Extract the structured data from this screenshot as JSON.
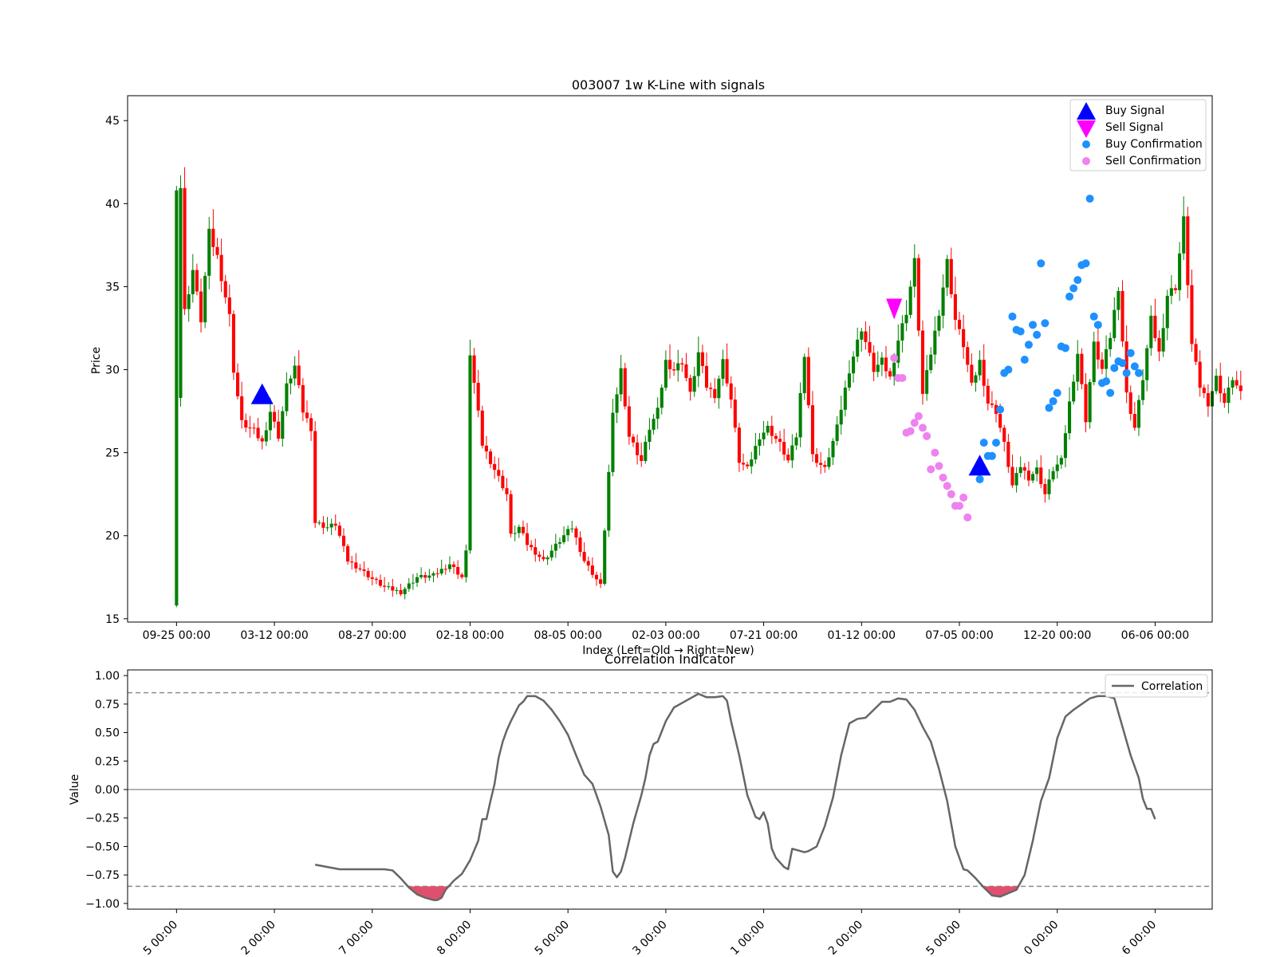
{
  "chart_data": [
    {
      "type": "candlestick",
      "title": "003007 1w K-Line with signals",
      "xlabel": "Index (Left=Old → Right=New)",
      "ylabel": "Price",
      "ylim": [
        14.8,
        46.5
      ],
      "yticks": [
        15,
        20,
        25,
        30,
        35,
        40,
        45
      ],
      "xtick_labels": [
        "09-25 00:00",
        "03-12 00:00",
        "08-27 00:00",
        "02-18 00:00",
        "08-05 00:00",
        "02-03 00:00",
        "07-21 00:00",
        "01-12 00:00",
        "07-05 00:00",
        "12-20 00:00",
        "06-06 00:00"
      ],
      "xtick_index": [
        0,
        24,
        48,
        72,
        96,
        120,
        144,
        168,
        192,
        216,
        240
      ],
      "xlim": [
        -12,
        254
      ],
      "candle_colors": {
        "up": "#008000",
        "down": "#ff0000"
      },
      "close_anchors": [
        [
          0,
          28.3
        ],
        [
          1,
          41.0
        ],
        [
          2,
          33.5
        ],
        [
          4,
          36.0
        ],
        [
          6,
          33.0
        ],
        [
          8,
          38.2
        ],
        [
          10,
          36.8
        ],
        [
          13,
          33.2
        ],
        [
          14,
          30.0
        ],
        [
          16,
          26.8
        ],
        [
          19,
          26.3
        ],
        [
          21,
          25.6
        ],
        [
          23,
          27.5
        ],
        [
          25,
          26.0
        ],
        [
          27,
          29.0
        ],
        [
          29,
          30.2
        ],
        [
          31,
          27.5
        ],
        [
          33,
          26.5
        ],
        [
          34,
          20.8
        ],
        [
          37,
          20.5
        ],
        [
          39,
          20.7
        ],
        [
          42,
          18.5
        ],
        [
          45,
          18.0
        ],
        [
          48,
          17.4
        ],
        [
          51,
          16.9
        ],
        [
          55,
          16.6
        ],
        [
          59,
          17.5
        ],
        [
          63,
          17.6
        ],
        [
          67,
          18.3
        ],
        [
          70,
          17.5
        ],
        [
          71,
          19.0
        ],
        [
          72,
          31.0
        ],
        [
          75,
          25.5
        ],
        [
          78,
          24.0
        ],
        [
          81,
          22.5
        ],
        [
          82,
          20.0
        ],
        [
          84,
          20.5
        ],
        [
          86,
          19.5
        ],
        [
          90,
          18.5
        ],
        [
          95,
          20.0
        ],
        [
          97,
          20.5
        ],
        [
          100,
          18.5
        ],
        [
          104,
          17.0
        ],
        [
          107,
          27.2
        ],
        [
          109,
          30.0
        ],
        [
          111,
          26.0
        ],
        [
          114,
          24.5
        ],
        [
          116,
          26.5
        ],
        [
          118,
          27.5
        ],
        [
          120,
          30.5
        ],
        [
          122,
          30.0
        ],
        [
          124,
          30.5
        ],
        [
          126,
          28.5
        ],
        [
          128,
          31.0
        ],
        [
          130,
          29.0
        ],
        [
          132,
          28.5
        ],
        [
          134,
          30.5
        ],
        [
          136,
          28.2
        ],
        [
          138,
          24.5
        ],
        [
          140,
          24.0
        ],
        [
          143,
          26.0
        ],
        [
          145,
          26.5
        ],
        [
          148,
          25.5
        ],
        [
          150,
          24.5
        ],
        [
          152,
          26.0
        ],
        [
          154,
          31.0
        ],
        [
          156,
          24.8
        ],
        [
          159,
          24.0
        ],
        [
          162,
          26.5
        ],
        [
          165,
          30.0
        ],
        [
          168,
          32.5
        ],
        [
          171,
          30.0
        ],
        [
          173,
          30.5
        ],
        [
          175,
          29.5
        ],
        [
          177,
          31.8
        ],
        [
          179,
          33.5
        ],
        [
          181,
          36.5
        ],
        [
          183,
          28.5
        ],
        [
          185,
          31.0
        ],
        [
          187,
          33.5
        ],
        [
          189,
          36.5
        ],
        [
          191,
          33.0
        ],
        [
          193,
          31.5
        ],
        [
          195,
          29.0
        ],
        [
          197,
          30.5
        ],
        [
          199,
          28.0
        ],
        [
          201,
          27.5
        ],
        [
          203,
          25.5
        ],
        [
          205,
          23.0
        ],
        [
          207,
          24.2
        ],
        [
          209,
          23.5
        ],
        [
          211,
          24.0
        ],
        [
          213,
          22.5
        ],
        [
          215,
          24.0
        ],
        [
          217,
          24.5
        ],
        [
          219,
          28.0
        ],
        [
          221,
          31.0
        ],
        [
          223,
          27.0
        ],
        [
          225,
          31.5
        ],
        [
          227,
          30.0
        ],
        [
          229,
          32.0
        ],
        [
          231,
          35.0
        ],
        [
          233,
          28.5
        ],
        [
          235,
          26.5
        ],
        [
          237,
          29.5
        ],
        [
          239,
          33.0
        ],
        [
          241,
          31.0
        ],
        [
          243,
          34.5
        ],
        [
          245,
          35.0
        ],
        [
          247,
          39.0
        ],
        [
          249,
          31.5
        ],
        [
          251,
          29.0
        ],
        [
          253,
          28.0
        ],
        [
          255,
          29.5
        ],
        [
          257,
          28.0
        ],
        [
          259,
          29.5
        ],
        [
          261,
          28.5
        ]
      ],
      "annotations": {
        "buy_signal_label": "Buy Signal",
        "sell_signal_label": "Sell Signal",
        "buy_confirmation_label": "Buy Confirmation",
        "sell_confirmation_label": "Sell Confirmation",
        "buy_signals": [
          [
            21,
            28.5
          ],
          [
            197,
            24.2
          ]
        ],
        "sell_signals": [
          [
            176,
            33.7
          ]
        ],
        "buy_confirmations": [
          [
            197,
            23.4
          ],
          [
            198,
            25.6
          ],
          [
            199,
            24.8
          ],
          [
            200,
            24.8
          ],
          [
            201,
            25.6
          ],
          [
            202,
            27.6
          ],
          [
            203,
            29.8
          ],
          [
            204,
            30.0
          ],
          [
            205,
            33.2
          ],
          [
            206,
            32.4
          ],
          [
            207,
            32.3
          ],
          [
            208,
            30.6
          ],
          [
            209,
            31.5
          ],
          [
            210,
            32.7
          ],
          [
            211,
            32.1
          ],
          [
            212,
            36.4
          ],
          [
            213,
            32.8
          ],
          [
            214,
            27.7
          ],
          [
            215,
            28.1
          ],
          [
            216,
            28.6
          ],
          [
            217,
            31.4
          ],
          [
            218,
            31.3
          ],
          [
            219,
            34.4
          ],
          [
            220,
            34.9
          ],
          [
            221,
            35.4
          ],
          [
            222,
            36.3
          ],
          [
            223,
            36.4
          ],
          [
            224,
            40.3
          ],
          [
            225,
            33.2
          ],
          [
            226,
            32.7
          ],
          [
            227,
            29.2
          ],
          [
            228,
            29.3
          ],
          [
            229,
            28.6
          ],
          [
            230,
            30.1
          ],
          [
            231,
            30.5
          ],
          [
            232,
            30.4
          ],
          [
            233,
            29.8
          ],
          [
            234,
            31.0
          ],
          [
            235,
            30.2
          ],
          [
            236,
            29.8
          ]
        ],
        "sell_confirmations": [
          [
            176,
            30.7
          ],
          [
            177,
            29.5
          ],
          [
            178,
            29.5
          ],
          [
            179,
            26.2
          ],
          [
            180,
            26.3
          ],
          [
            181,
            26.8
          ],
          [
            182,
            27.2
          ],
          [
            183,
            26.5
          ],
          [
            184,
            26.0
          ],
          [
            185,
            24.0
          ],
          [
            186,
            25.0
          ],
          [
            187,
            24.2
          ],
          [
            188,
            23.5
          ],
          [
            189,
            23.0
          ],
          [
            190,
            22.5
          ],
          [
            191,
            21.8
          ],
          [
            192,
            21.8
          ],
          [
            193,
            22.3
          ],
          [
            194,
            21.1
          ]
        ]
      },
      "legend_position": "top-right"
    },
    {
      "type": "line",
      "title": "Correlation Indicator",
      "ylabel": "Value",
      "ylim": [
        -1.05,
        1.05
      ],
      "yticks": [
        -1.0,
        -0.75,
        -0.5,
        -0.25,
        0.0,
        0.25,
        0.5,
        0.75,
        1.0
      ],
      "ytick_labels": [
        "−1.00",
        "−0.75",
        "−0.50",
        "−0.25",
        "0.00",
        "0.25",
        "0.50",
        "0.75",
        "1.00"
      ],
      "xtick_labels": [
        "5 00:00",
        "2 00:00",
        "7 00:00",
        "8 00:00",
        "5 00:00",
        "3 00:00",
        "1 00:00",
        "2 00:00",
        "5 00:00",
        "0 00:00",
        "6 00:00"
      ],
      "thresholds": [
        0.85,
        -0.85
      ],
      "legend_position": "top-right",
      "series": [
        {
          "name": "Correlation",
          "color": "#666666",
          "points": [
            [
              34,
              -0.66
            ],
            [
              37,
              -0.68
            ],
            [
              40,
              -0.7
            ],
            [
              44,
              -0.7
            ],
            [
              48,
              -0.7
            ],
            [
              51,
              -0.7
            ],
            [
              53,
              -0.71
            ],
            [
              55,
              -0.78
            ],
            [
              57,
              -0.86
            ],
            [
              59,
              -0.92
            ],
            [
              61,
              -0.95
            ],
            [
              63,
              -0.97
            ],
            [
              64,
              -0.97
            ],
            [
              65,
              -0.95
            ],
            [
              66,
              -0.88
            ],
            [
              68,
              -0.8
            ],
            [
              70,
              -0.74
            ],
            [
              72,
              -0.62
            ],
            [
              74,
              -0.45
            ],
            [
              75,
              -0.26
            ],
            [
              76,
              -0.26
            ],
            [
              77,
              -0.1
            ],
            [
              78,
              0.05
            ],
            [
              79,
              0.28
            ],
            [
              80,
              0.42
            ],
            [
              81,
              0.52
            ],
            [
              82,
              0.6
            ],
            [
              84,
              0.74
            ],
            [
              85,
              0.77
            ],
            [
              86,
              0.82
            ],
            [
              88,
              0.82
            ],
            [
              90,
              0.78
            ],
            [
              92,
              0.7
            ],
            [
              94,
              0.6
            ],
            [
              96,
              0.48
            ],
            [
              98,
              0.3
            ],
            [
              100,
              0.13
            ],
            [
              102,
              0.05
            ],
            [
              104,
              -0.15
            ],
            [
              106,
              -0.4
            ],
            [
              107,
              -0.72
            ],
            [
              108,
              -0.77
            ],
            [
              109,
              -0.72
            ],
            [
              110,
              -0.6
            ],
            [
              112,
              -0.3
            ],
            [
              114,
              -0.05
            ],
            [
              115,
              0.1
            ],
            [
              116,
              0.3
            ],
            [
              117,
              0.4
            ],
            [
              118,
              0.42
            ],
            [
              120,
              0.6
            ],
            [
              122,
              0.72
            ],
            [
              124,
              0.76
            ],
            [
              126,
              0.8
            ],
            [
              128,
              0.84
            ],
            [
              130,
              0.81
            ],
            [
              132,
              0.81
            ],
            [
              134,
              0.82
            ],
            [
              135,
              0.78
            ],
            [
              136,
              0.6
            ],
            [
              138,
              0.3
            ],
            [
              140,
              -0.05
            ],
            [
              142,
              -0.24
            ],
            [
              143,
              -0.26
            ],
            [
              144,
              -0.2
            ],
            [
              145,
              -0.3
            ],
            [
              146,
              -0.52
            ],
            [
              147,
              -0.6
            ],
            [
              149,
              -0.68
            ],
            [
              150,
              -0.7
            ],
            [
              151,
              -0.52
            ],
            [
              152,
              -0.53
            ],
            [
              154,
              -0.55
            ],
            [
              155,
              -0.54
            ],
            [
              157,
              -0.5
            ],
            [
              159,
              -0.32
            ],
            [
              161,
              -0.07
            ],
            [
              163,
              0.3
            ],
            [
              165,
              0.58
            ],
            [
              167,
              0.62
            ],
            [
              169,
              0.63
            ],
            [
              171,
              0.7
            ],
            [
              173,
              0.77
            ],
            [
              175,
              0.77
            ],
            [
              177,
              0.8
            ],
            [
              179,
              0.79
            ],
            [
              181,
              0.7
            ],
            [
              183,
              0.55
            ],
            [
              185,
              0.42
            ],
            [
              187,
              0.18
            ],
            [
              189,
              -0.1
            ],
            [
              191,
              -0.5
            ],
            [
              192,
              -0.6
            ],
            [
              193,
              -0.7
            ],
            [
              194,
              -0.71
            ],
            [
              196,
              -0.78
            ],
            [
              198,
              -0.86
            ],
            [
              200,
              -0.93
            ],
            [
              202,
              -0.94
            ],
            [
              204,
              -0.91
            ],
            [
              206,
              -0.88
            ],
            [
              208,
              -0.75
            ],
            [
              210,
              -0.45
            ],
            [
              212,
              -0.1
            ],
            [
              214,
              0.1
            ],
            [
              216,
              0.45
            ],
            [
              218,
              0.64
            ],
            [
              220,
              0.7
            ],
            [
              222,
              0.75
            ],
            [
              224,
              0.8
            ],
            [
              226,
              0.82
            ],
            [
              228,
              0.82
            ],
            [
              230,
              0.8
            ],
            [
              232,
              0.55
            ],
            [
              234,
              0.3
            ],
            [
              236,
              0.1
            ],
            [
              237,
              -0.08
            ],
            [
              238,
              -0.17
            ],
            [
              239,
              -0.17
            ],
            [
              240,
              -0.26
            ]
          ]
        }
      ]
    }
  ]
}
